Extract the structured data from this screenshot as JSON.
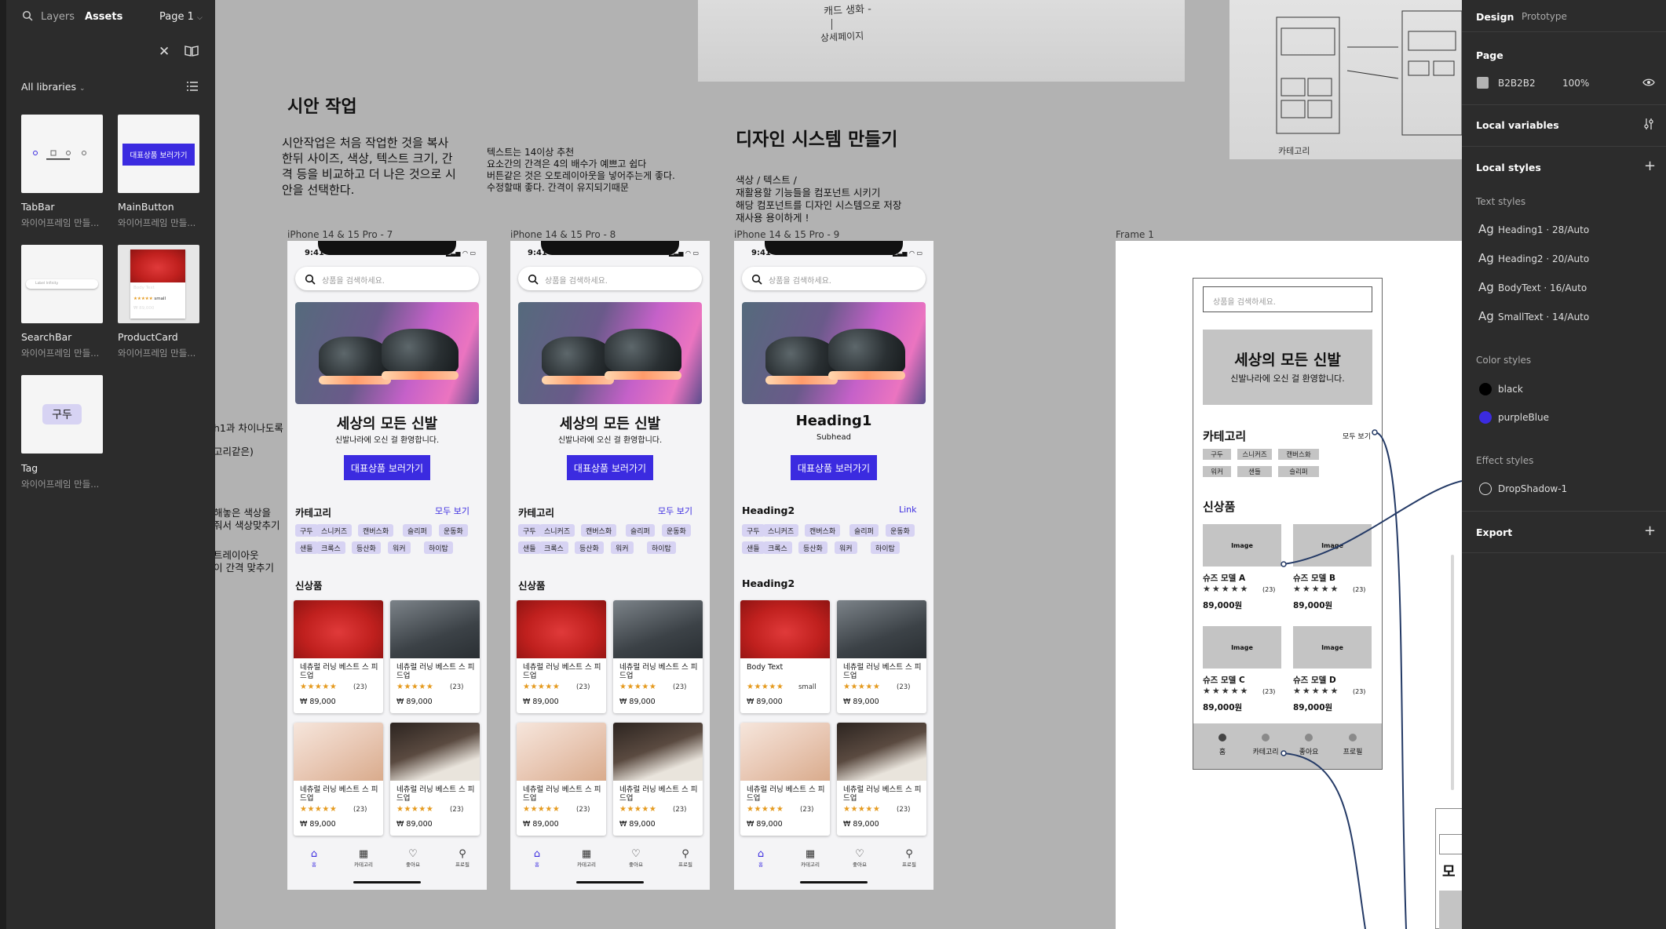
{
  "left_panel": {
    "tabs": {
      "layers": "Layers",
      "assets": "Assets",
      "page": "Page 1"
    },
    "libraries": "All libraries",
    "assets": [
      {
        "name": "TabBar",
        "sub": "와이어프레임 만들..."
      },
      {
        "name": "MainButton",
        "sub": "와이어프레임 만들...",
        "button_text": "대표상품 보러가기"
      },
      {
        "name": "SearchBar",
        "sub": "와이어프레임 만들...",
        "placeholder": "Label Infinity"
      },
      {
        "name": "ProductCard",
        "sub": "와이어프레임 만들...",
        "body_text": "Body Text",
        "small": "small",
        "price": "₩ 89,000"
      },
      {
        "name": "Tag",
        "sub": "와이어프레임 만들...",
        "tag_text": "구두"
      }
    ]
  },
  "right_panel": {
    "tabs": {
      "design": "Design",
      "prototype": "Prototype"
    },
    "page": {
      "title": "Page",
      "color_hex": "B2B2B2",
      "opacity": "100%"
    },
    "local_variables": "Local variables",
    "local_styles": "Local styles",
    "text_styles_title": "Text styles",
    "text_styles": [
      {
        "ag": "Ag",
        "name": "Heading1 · 28/Auto"
      },
      {
        "ag": "Ag",
        "name": "Heading2 · 20/Auto"
      },
      {
        "ag": "Ag",
        "name": "BodyText · 16/Auto"
      },
      {
        "ag": "Ag",
        "name": "SmallText · 14/Auto"
      }
    ],
    "color_styles_title": "Color styles",
    "color_styles": [
      {
        "name": "black",
        "color": "#000000"
      },
      {
        "name": "purpleBlue",
        "color": "#3b2be0"
      }
    ],
    "effect_styles_title": "Effect styles",
    "effect_styles": [
      {
        "name": "DropShadow-1"
      }
    ],
    "export": "Export"
  },
  "canvas": {
    "notes": {
      "title1": "시안 작업",
      "body1": [
        "시안작업은 처음 작업한 것을 복사",
        "한뒤 사이즈, 색상, 텍스트 크기, 간",
        "격 등을 비교하고 더 나은 것으로 시",
        "안을 선택한다."
      ],
      "body2": [
        "텍스트는 14이상 추천",
        "요소간의 간격은 4의 배수가 예쁘고 쉽다",
        "버튼같은 것은 오토레이아웃을 넣어주는게 좋다.",
        "수정할때 좋다. 간격이 유지되기때문"
      ],
      "title2": "디자인 시스템 만들기",
      "body3": [
        "색상 / 텍스트 /",
        "재활용할 기능들을 컴포넌트 시키기",
        "해당 컴포넌트를 디자인 시스템으로 저장",
        "재사용 용이하게 !"
      ],
      "side": [
        "h1과 차이나도록",
        "고리같은)",
        "해놓은 색상을",
        "줘서 색상맞추기",
        "트레이아웃",
        "이 간격 맞추기"
      ]
    },
    "frames": [
      {
        "label": "iPhone 14 & 15 Pro - 7"
      },
      {
        "label": "iPhone 14 & 15 Pro - 8"
      },
      {
        "label": "iPhone 14 & 15 Pro - 9"
      },
      {
        "label": "Frame 1"
      }
    ],
    "phone": {
      "time": "9:41",
      "search_placeholder": "상품을 검색하세요.",
      "hero_title": "세상의 모든 신발",
      "hero_sub": "신발나라에 오신 걸 환영합니다.",
      "main_button": "대표상품 보러가기",
      "category": "카테고리",
      "see_all": "모두 보기",
      "chips_row1": [
        "구두",
        "스니커즈",
        "캔버스화",
        "슬리퍼",
        "운동화"
      ],
      "chips_row2": [
        "샌들",
        "크록스",
        "등산화",
        "워커",
        "하이탑"
      ],
      "new_items": "신상품",
      "product_name": "네츄럴 러닝 베스트 스 피드업",
      "stars": "★★★★★",
      "count": "(23)",
      "price": "₩ 89,000",
      "nav": [
        "홈",
        "카테고리",
        "좋아요",
        "프로필"
      ]
    },
    "phone3": {
      "hero_title": "Heading1",
      "hero_sub": "Subhead",
      "category": "Heading2",
      "see_all": "Link",
      "new_items": "Heading2",
      "card1_text": "Body Text",
      "card1_small": "small"
    },
    "wireframe": {
      "search_placeholder": "상품을 검색하세요.",
      "hero_title": "세상의 모든 신발",
      "hero_sub": "신발나라에 오신 걸 환영합니다.",
      "category": "카테고리",
      "see_all": "모두 보기",
      "chips_row1": [
        "구두",
        "스니커즈",
        "캔버스화"
      ],
      "chips_row2": [
        "워커",
        "샌들",
        "슬리퍼"
      ],
      "new_items": "신상품",
      "image_label": "Image",
      "products": [
        {
          "name": "슈즈 모델 A",
          "price": "89,000원"
        },
        {
          "name": "슈즈 모델 B",
          "price": "89,000원"
        },
        {
          "name": "슈즈 모델 C",
          "price": "89,000원"
        },
        {
          "name": "슈즈 모델 D",
          "price": "89,000원"
        }
      ],
      "stars": "★★★★★",
      "count": "(23)",
      "nav": [
        "홈",
        "카테고리",
        "좋아요",
        "프로필"
      ],
      "partial": "모"
    },
    "sketch_text": [
      "캐드 생화 -",
      "상세페이지"
    ]
  }
}
